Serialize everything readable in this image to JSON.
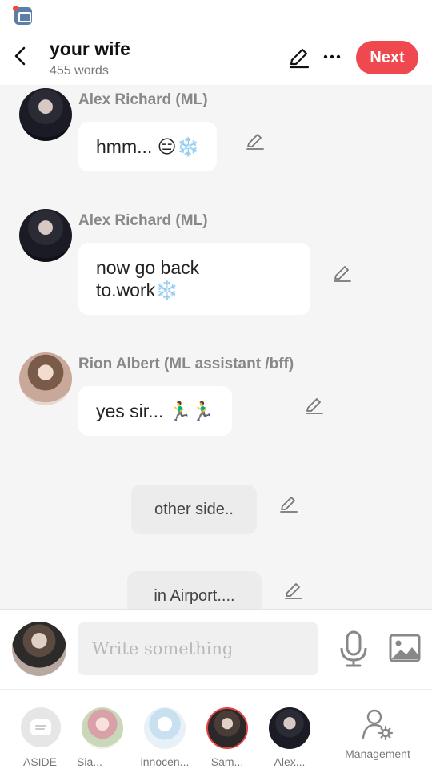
{
  "header": {
    "title": "your wife",
    "word_count": "455 words",
    "next_label": "Next"
  },
  "messages": [
    {
      "sender": "Alex Richard  (ML)",
      "text": "hmm... 😑❄️"
    },
    {
      "sender": "Alex Richard  (ML)",
      "text_line1": "now go back",
      "text_line2": "to.work❄️"
    },
    {
      "sender": "Rion Albert  (ML assistant /bff)",
      "text": "yes  sir... 🏃‍♂️🏃‍♂️"
    },
    {
      "aside": "other side.."
    },
    {
      "aside": "in Airport...."
    }
  ],
  "composer": {
    "placeholder": "Write something"
  },
  "cast": [
    {
      "label": "ASIDE"
    },
    {
      "label": "Sia..."
    },
    {
      "label": "innocen..."
    },
    {
      "label": "Sam..."
    },
    {
      "label": "Alex..."
    }
  ],
  "management_label": "Management",
  "colors": {
    "accent": "#f0484f",
    "selected_ring": "#e24444"
  }
}
